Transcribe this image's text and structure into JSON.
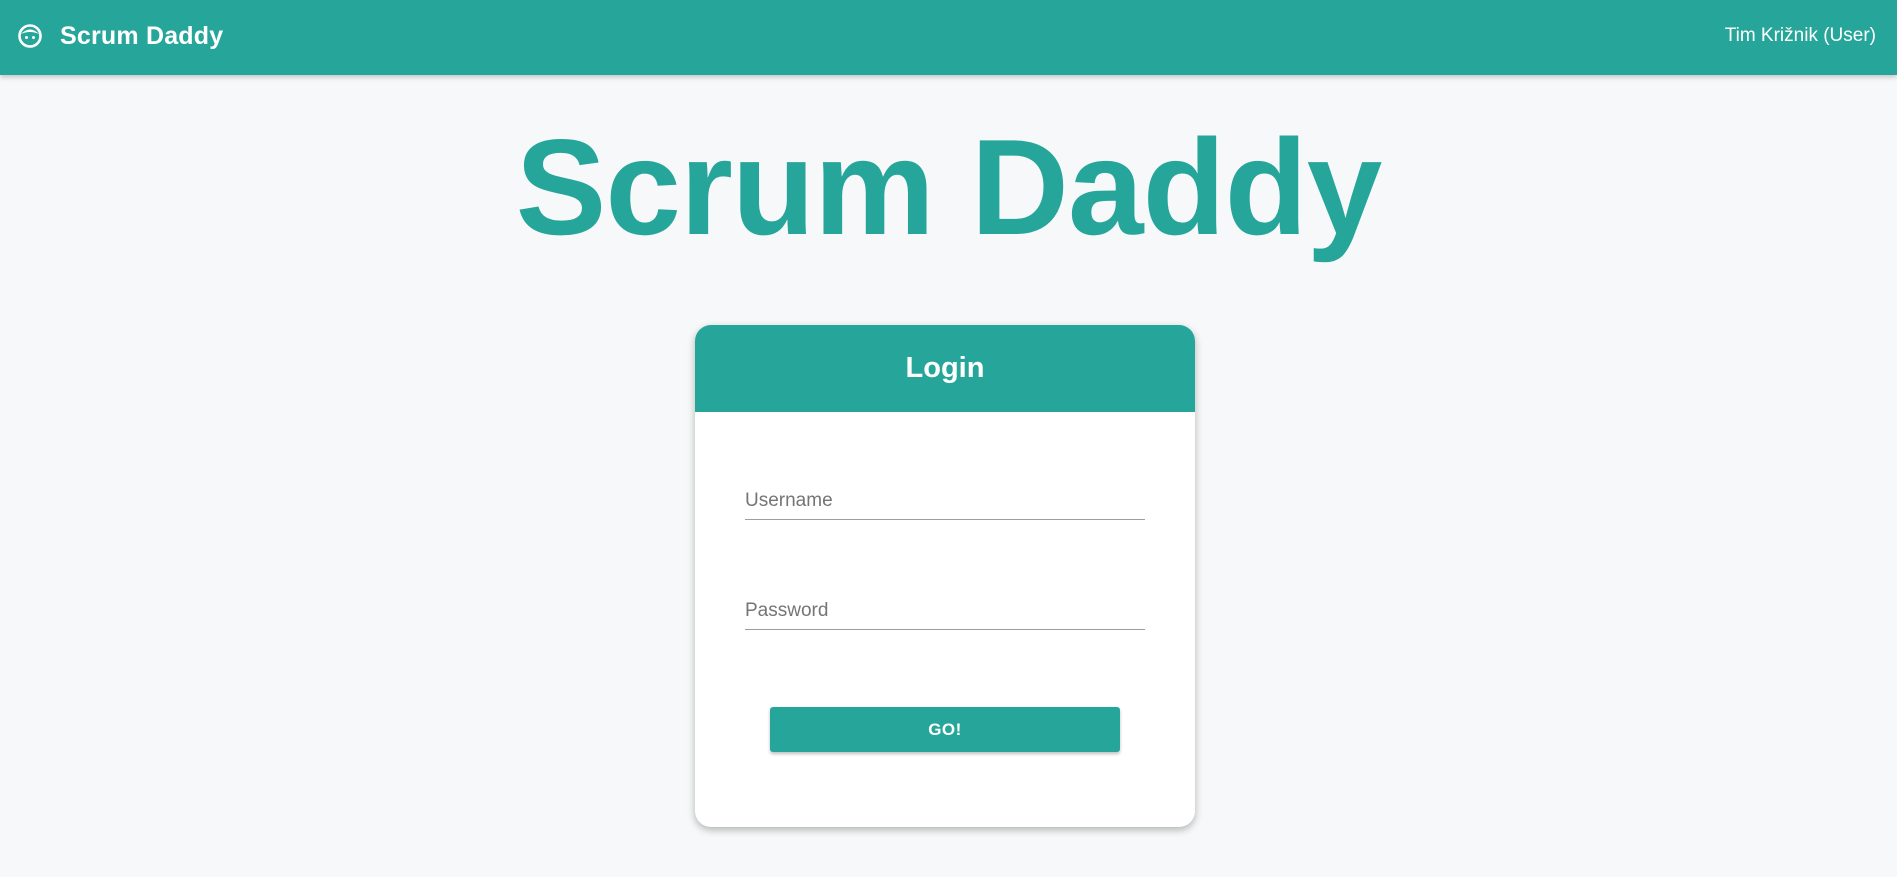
{
  "header": {
    "brand_title": "Scrum Daddy",
    "brand_icon": "face-icon",
    "user_label": "Tim Križnik (User)"
  },
  "hero": {
    "title": "Scrum Daddy"
  },
  "login_card": {
    "title": "Login",
    "username_placeholder": "Username",
    "username_value": "",
    "password_placeholder": "Password",
    "password_value": "",
    "submit_label": "GO!"
  },
  "colors": {
    "accent": "#26a69a",
    "background": "#f6f8f9",
    "card_background": "#ffffff"
  }
}
